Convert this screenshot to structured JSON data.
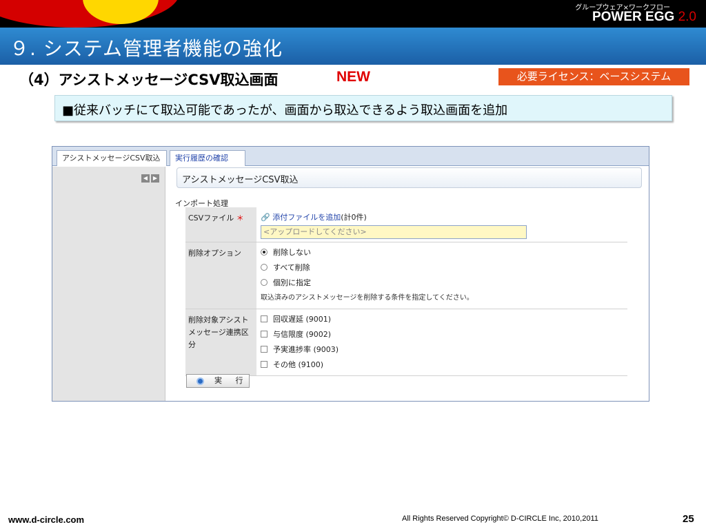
{
  "brand": {
    "subtitle": "グループウェア×ワークフロー",
    "name": "POWER EGG",
    "version": "2.0"
  },
  "slide": {
    "title": "９. システム管理者機能の強化",
    "subtitle": "（4）アシストメッセージCSV取込画面",
    "new_tag": "NEW",
    "license": "必要ライセンス：ベースシステム",
    "description": "■従来バッチにて取込可能であったが、画面から取込できるよう取込画面を追加"
  },
  "app": {
    "tabs": [
      {
        "label": "アシストメッセージCSV取込"
      },
      {
        "label": "実行履歴の確認"
      }
    ],
    "page_header": "アシストメッセージCSV取込",
    "section_title": "インポート処理",
    "csv": {
      "label": "CSVファイル",
      "required_mark": "＊",
      "attach_link": "添付ファイルを追加",
      "attach_count": "(計0件)",
      "upload_placeholder": "<アップロードしてください>"
    },
    "delete_option": {
      "label": "削除オプション",
      "options": [
        "削除しない",
        "すべて削除",
        "個別に指定"
      ],
      "selected": "削除しない",
      "note": "取込済みのアシストメッセージを削除する条件を指定してください。"
    },
    "target": {
      "label_lines": [
        "削除対象アシスト",
        "メッセージ連携区",
        "分"
      ],
      "options": [
        "回収遅延 (9001)",
        "与信限度 (9002)",
        "予実進捗率 (9003)",
        "その他 (9100)"
      ]
    },
    "execute_label": "実 行"
  },
  "footer": {
    "website": "www.d-circle.com",
    "copyright": "All Rights Reserved Copyright© D-CIRCLE  Inc, 2010,2011",
    "page": "25"
  }
}
